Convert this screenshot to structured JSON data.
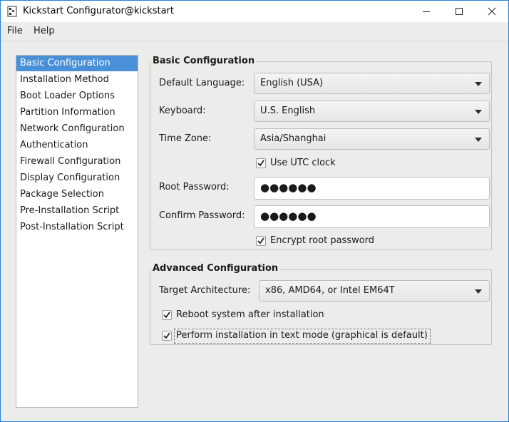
{
  "window": {
    "title": "Kickstart Configurator@kickstart"
  },
  "menubar": {
    "items": [
      "File",
      "Help"
    ]
  },
  "sidebar": {
    "items": [
      {
        "label": "Basic Configuration",
        "selected": true
      },
      {
        "label": "Installation Method"
      },
      {
        "label": "Boot Loader Options"
      },
      {
        "label": "Partition Information"
      },
      {
        "label": "Network Configuration"
      },
      {
        "label": "Authentication"
      },
      {
        "label": "Firewall Configuration"
      },
      {
        "label": "Display Configuration"
      },
      {
        "label": "Package Selection"
      },
      {
        "label": "Pre-Installation Script"
      },
      {
        "label": "Post-Installation Script"
      }
    ]
  },
  "basic": {
    "title": "Basic Configuration",
    "default_language_label": "Default Language:",
    "default_language_value": "English (USA)",
    "keyboard_label": "Keyboard:",
    "keyboard_value": "U.S. English",
    "timezone_label": "Time Zone:",
    "timezone_value": "Asia/Shanghai",
    "utc_clock_label": "Use UTC clock",
    "utc_clock_checked": true,
    "root_password_label": "Root Password:",
    "root_password_value": "●●●●●●",
    "confirm_password_label": "Confirm Password:",
    "confirm_password_value": "●●●●●●",
    "encrypt_label": "Encrypt root password",
    "encrypt_checked": true
  },
  "advanced": {
    "title": "Advanced Configuration",
    "target_arch_label": "Target Architecture:",
    "target_arch_value": "x86, AMD64, or Intel EM64T",
    "reboot_label": "Reboot system after installation",
    "reboot_checked": true,
    "text_mode_label": "Perform installation in text mode (graphical is default)",
    "text_mode_checked": true
  },
  "colors": {
    "accent": "#4a90d9",
    "window_border": "#2b7fd8",
    "background": "#ececeb"
  }
}
